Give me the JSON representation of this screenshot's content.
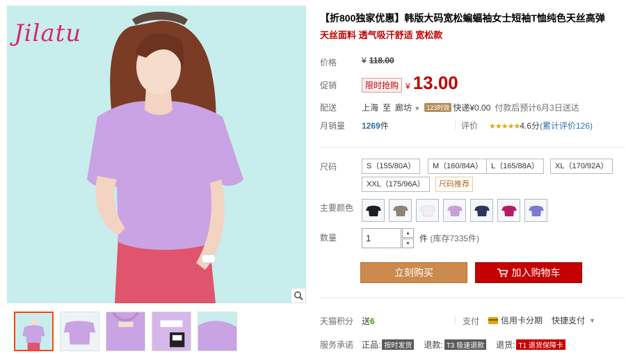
{
  "gallery": {
    "brand": "Jilatu",
    "thumbnail_count": 5
  },
  "product": {
    "title": "【折800独家优惠】韩版大码宽松蝙蝠袖女士短袖T恤纯色天丝高弹",
    "subtitle": "天丝面料 透气吸汗舒适 宽松款"
  },
  "price": {
    "label": "价格",
    "currency": "¥",
    "original": "118.00"
  },
  "promo": {
    "label": "促销",
    "tag": "限时抢购",
    "currency": "¥",
    "amount": "13.00"
  },
  "shipping": {
    "label": "配送",
    "from": "上海",
    "to_word": "至",
    "dest": "廊坊",
    "badge": "123时效",
    "fee": "快递¥0.00",
    "note": "付款后预计6月3日送达"
  },
  "sales": {
    "label": "月销量",
    "count": "1269",
    "unit": "件",
    "rating_label": "评价",
    "stars": "★★★★★",
    "score": "4.6分",
    "review": "(累计评价126)"
  },
  "size": {
    "label": "尺码",
    "options": [
      "S（155/80A）",
      "M（160/84A）",
      "L（165/88A）",
      "XL（170/92A）",
      "XXL（175/96A）"
    ],
    "chart_link": "尺码推荐"
  },
  "color": {
    "label": "主要颜色",
    "swatches": [
      {
        "name": "black",
        "hex": "#1e1e1e"
      },
      {
        "name": "khaki",
        "hex": "#8c8477"
      },
      {
        "name": "white",
        "hex": "#f2eef2"
      },
      {
        "name": "light-purple",
        "hex": "#c7a0d8"
      },
      {
        "name": "navy",
        "hex": "#2e3558"
      },
      {
        "name": "rose",
        "hex": "#b51c63"
      },
      {
        "name": "blue-violet",
        "hex": "#7e7ad4"
      }
    ]
  },
  "quantity": {
    "label": "数量",
    "value": "1",
    "unit": "件",
    "stock": "(库存7335件)"
  },
  "actions": {
    "buy": "立刻购买",
    "cart": "加入购物车"
  },
  "points": {
    "label": "天猫积分",
    "prefix": "送",
    "value": "6"
  },
  "payment": {
    "label": "支付",
    "option1": "信用卡分期",
    "option2": "快捷支付"
  },
  "service": {
    "label": "服务承诺",
    "items": [
      {
        "prefix": "正品:",
        "tag": "按时发货"
      },
      {
        "prefix": "退款:",
        "tag": "T3 极速退款"
      },
      {
        "prefix": "退货:",
        "tag": "T1 退货保障卡"
      }
    ]
  },
  "colors": {
    "accent_red": "#c40000",
    "buy_orange": "#cc8a4d",
    "photo_bg": "#c7eeec",
    "shirt": "#c9a3e3"
  }
}
